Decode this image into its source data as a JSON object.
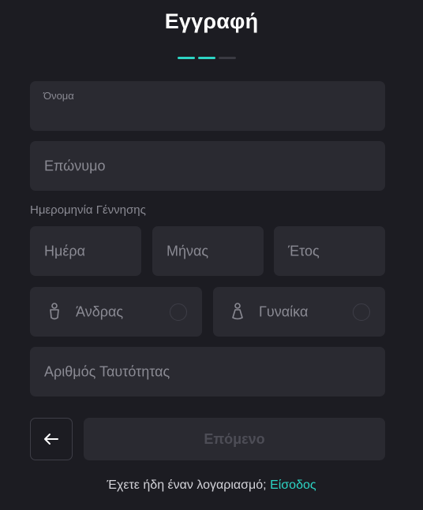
{
  "form": {
    "title": "Εγγραφή",
    "steps": [
      {
        "active": true
      },
      {
        "active": true
      },
      {
        "active": false
      }
    ],
    "first_name": {
      "label": "Όνομα",
      "value": ""
    },
    "last_name": {
      "placeholder": "Επώνυμο"
    },
    "dob": {
      "label": "Ημερομηνία Γέννησης",
      "day_placeholder": "Ημέρα",
      "month_placeholder": "Μήνας",
      "year_placeholder": "Έτος"
    },
    "gender": {
      "male": {
        "label": "Άνδρας",
        "icon": "male-person-icon",
        "selected": false
      },
      "female": {
        "label": "Γυναίκα",
        "icon": "female-person-icon",
        "selected": false
      }
    },
    "id_number": {
      "placeholder": "Αριθμός Ταυτότητας"
    },
    "back_button": {
      "icon": "arrow-left-icon"
    },
    "next_button": {
      "label": "Επόμενο",
      "enabled": false
    },
    "footer": {
      "text": "Έχετε ήδη έναν λογαριασμό; ",
      "link": "Είσοδος"
    }
  },
  "colors": {
    "background": "#1c1c22",
    "field": "#2a2a31",
    "accent": "#2dd4c4",
    "muted_text": "#8a8a93"
  }
}
